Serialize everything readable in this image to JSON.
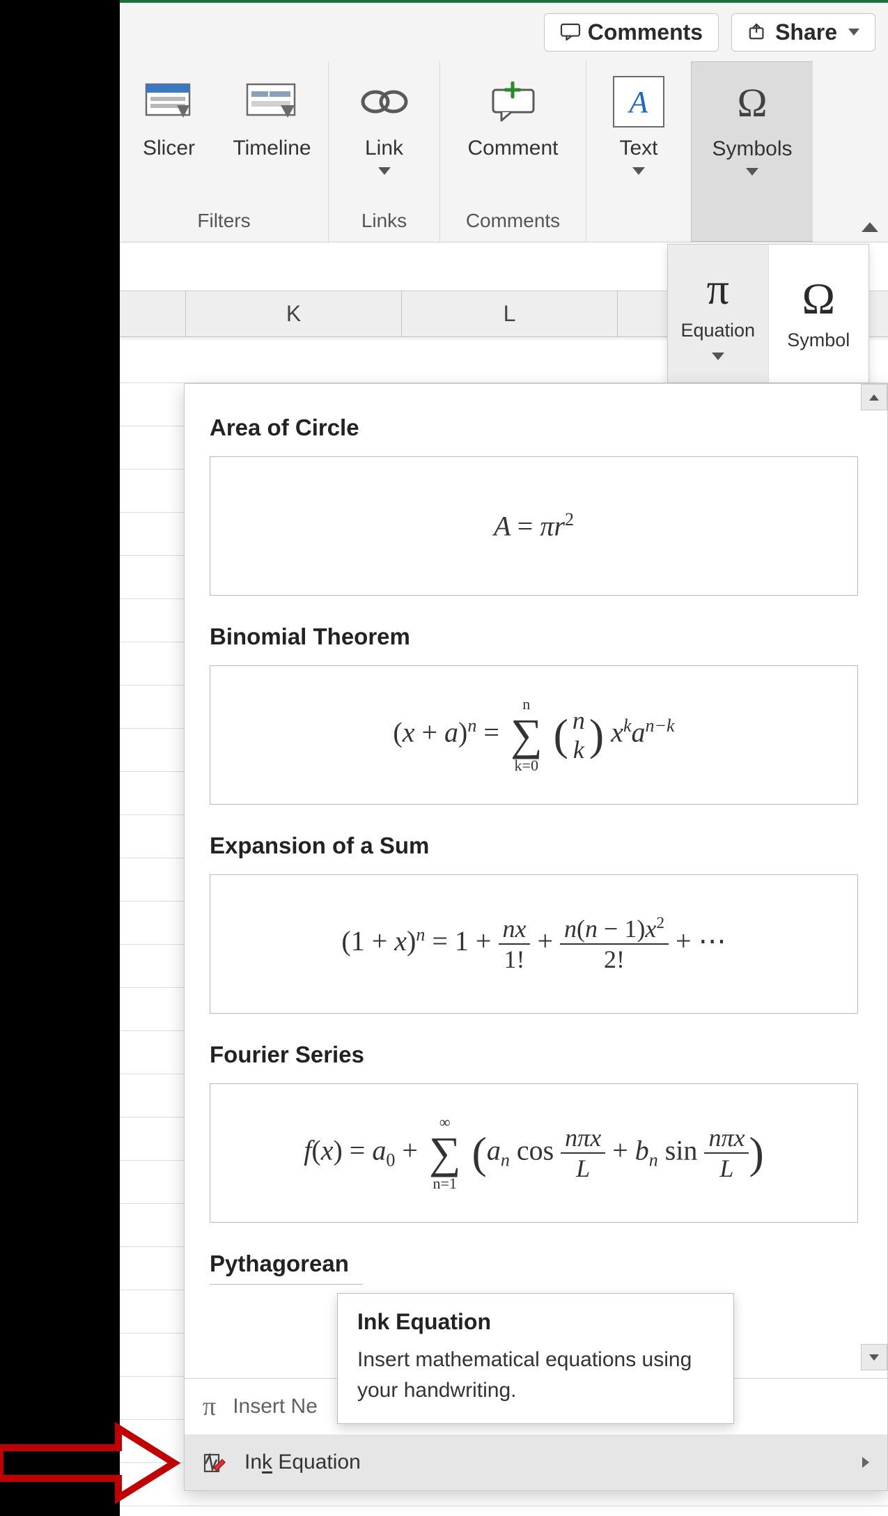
{
  "topbar": {
    "comments_label": "Comments",
    "share_label": "Share"
  },
  "ribbon": {
    "slicer_label": "Slicer",
    "timeline_label": "Timeline",
    "filters_group": "Filters",
    "link_label": "Link",
    "links_group": "Links",
    "comment_label": "Comment",
    "comments_group": "Comments",
    "text_label": "Text",
    "symbols_label": "Symbols"
  },
  "symbols_dropdown": {
    "equation_label": "Equation",
    "symbol_label": "Symbol"
  },
  "columns": {
    "k": "K",
    "l": "L"
  },
  "gallery": {
    "items": [
      {
        "title": "Area of Circle"
      },
      {
        "title": "Binomial Theorem"
      },
      {
        "title": "Expansion of a Sum"
      },
      {
        "title": "Fourier Series"
      },
      {
        "title": "Pythagorean"
      }
    ],
    "insert_new_label": "Insert Ne",
    "insert_new_key": "N",
    "ink_equation_label": "Ink Equation",
    "ink_equation_prefix": "In",
    "ink_equation_key": "k",
    "ink_equation_suffix": " Equation"
  },
  "tooltip": {
    "title": "Ink Equation",
    "body": "Insert mathematical equations using your handwriting."
  }
}
